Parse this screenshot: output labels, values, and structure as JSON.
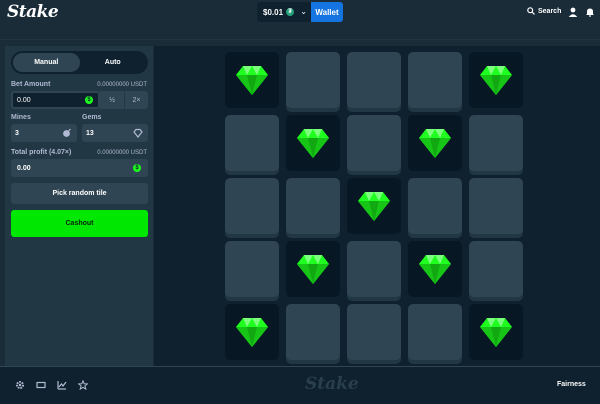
{
  "header": {
    "logo": "Stake",
    "balance": "$0.01",
    "currency_symbol": "₮",
    "wallet_label": "Wallet",
    "search_label": "Search"
  },
  "panel": {
    "tabs": [
      "Manual",
      "Auto"
    ],
    "active_tab": "Manual",
    "bet_amount_label": "Bet Amount",
    "bet_amount_usdt": "0.00000000 USDT",
    "bet_value": "0.00",
    "half_label": "½",
    "double_label": "2×",
    "mines_label": "Mines",
    "mines_value": "3",
    "gems_label": "Gems",
    "gems_value": "13",
    "profit_label": "Total profit (4.07×)",
    "profit_usdt": "0.00000000 USDT",
    "profit_value": "0.00",
    "random_label": "Pick random tile",
    "cashout_label": "Cashout",
    "coin_symbol": "$"
  },
  "grid": {
    "rows": 5,
    "cols": 5,
    "tiles": [
      "gem",
      "hidden",
      "hidden",
      "hidden",
      "gem",
      "hidden",
      "gem",
      "hidden",
      "gem",
      "hidden",
      "hidden",
      "hidden",
      "gem",
      "hidden",
      "hidden",
      "hidden",
      "gem",
      "hidden",
      "gem",
      "hidden",
      "gem",
      "hidden",
      "hidden",
      "hidden",
      "gem"
    ]
  },
  "footer": {
    "logo": "Stake",
    "fairness_label": "Fairness"
  },
  "colors": {
    "bg": "#1a2c38",
    "panel": "#213743",
    "tile": "#2f4553",
    "gem": "#1fff20",
    "cashout": "#00e701",
    "wallet": "#1475e1"
  }
}
